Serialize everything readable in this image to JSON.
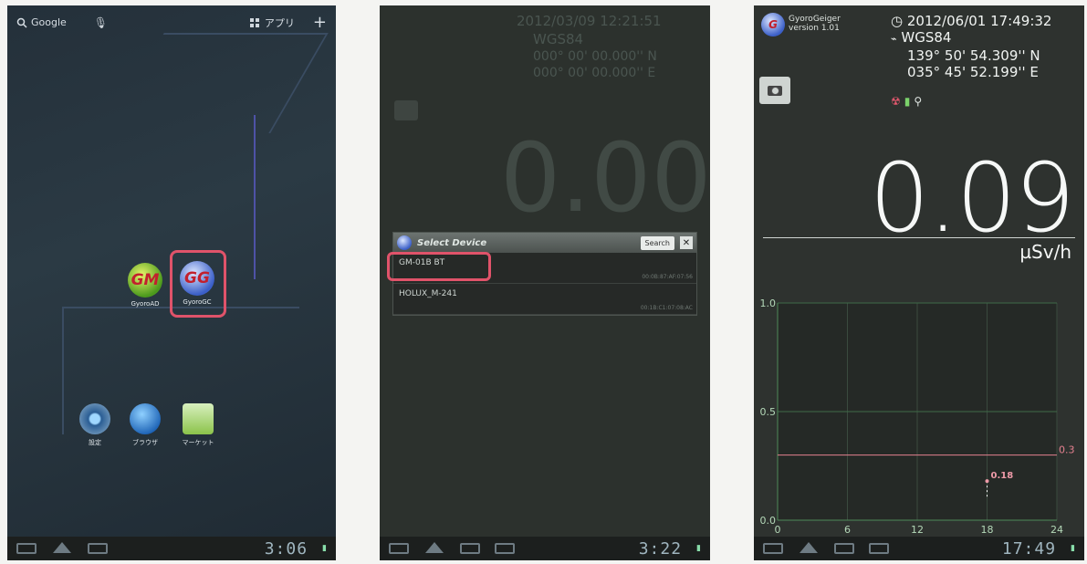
{
  "screen1": {
    "search_label": "Google",
    "apps_label": "アプリ",
    "apps": [
      {
        "label": "GyoroAD",
        "glyph": "GM"
      },
      {
        "label": "GyoroGC",
        "glyph": "GG"
      }
    ],
    "dock": [
      {
        "label": "設定",
        "icon": "settings-icon"
      },
      {
        "label": "ブラウザ",
        "icon": "browser-icon"
      },
      {
        "label": "マーケット",
        "icon": "market-icon"
      }
    ],
    "clock": "3:06"
  },
  "screen2": {
    "datetime": "2012/03/09 12:21:51",
    "datum": "WGS84",
    "lat": "000° 00' 00.000'' N",
    "lon": "000° 00' 00.000'' E",
    "bigval": "0.00",
    "dialog": {
      "title": "Select Device",
      "search_label": "Search",
      "close_label": "✕",
      "devices": [
        {
          "name": "GM-01B BT",
          "address": "00:0B:87:AF:07:56"
        },
        {
          "name": "HOLUX_M-241",
          "address": "00:1B:C1:07:08:AC"
        }
      ]
    },
    "clock": "3:22"
  },
  "screen3": {
    "app_name": "GyoroGeiger",
    "version": "version 1.01",
    "datetime": "2012/06/01 17:49:32",
    "datum": "WGS84",
    "coord1": "139° 50' 54.309'' N",
    "coord2": "035° 45' 52.199'' E",
    "value": "0.09",
    "unit": "µSv/h",
    "clock": "17:49",
    "chart_data": {
      "type": "line",
      "x": [
        18
      ],
      "y": [
        0.18
      ],
      "point_labels": [
        "0.18"
      ],
      "xticks": [
        "0",
        "6",
        "12",
        "18",
        "24"
      ],
      "yticks": [
        "0.0",
        "0.5",
        "1.0"
      ],
      "xlim": [
        0,
        24
      ],
      "ylim": [
        0,
        1.0
      ],
      "threshold": {
        "value": 0.3,
        "label": "0.3",
        "color": "#e4808f"
      },
      "grid": true
    }
  }
}
